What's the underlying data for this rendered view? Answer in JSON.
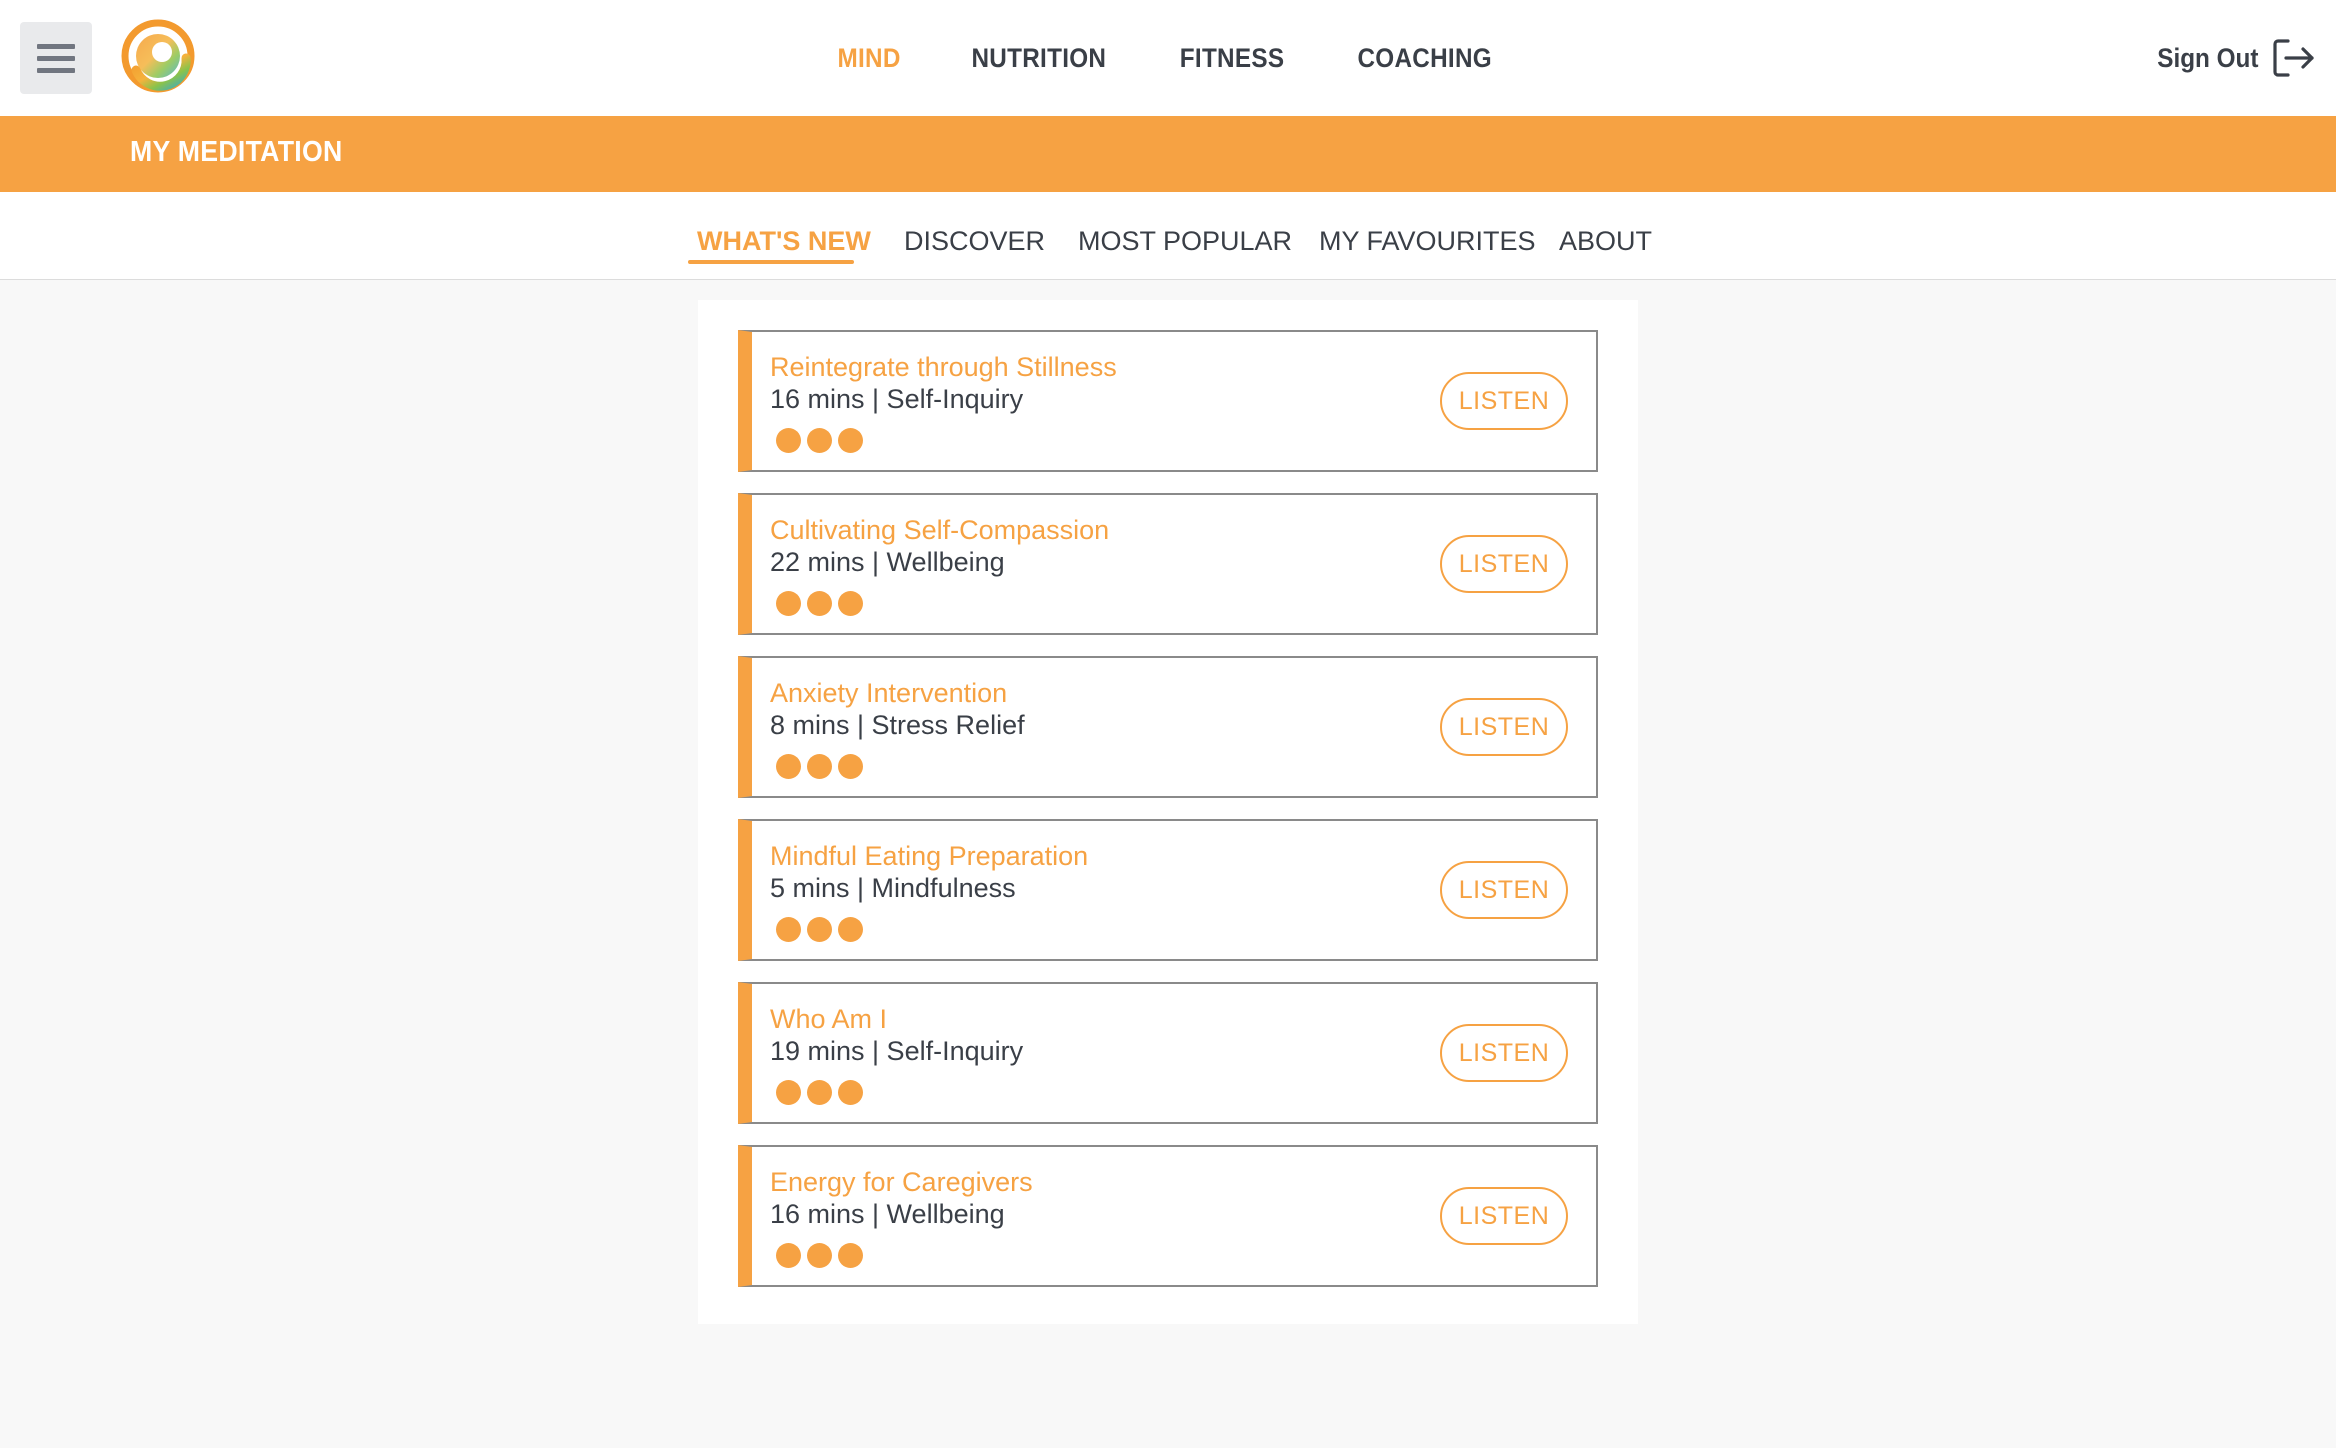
{
  "header": {
    "nav": [
      {
        "label": "MIND",
        "active": true
      },
      {
        "label": "NUTRITION",
        "active": false
      },
      {
        "label": "FITNESS",
        "active": false
      },
      {
        "label": "COACHING",
        "active": false
      }
    ],
    "sign_out_label": "Sign Out"
  },
  "band": {
    "title": "MY MEDITATION"
  },
  "tabs": [
    {
      "label": "WHAT'S NEW",
      "active": true
    },
    {
      "label": "DISCOVER",
      "active": false
    },
    {
      "label": "MOST POPULAR",
      "active": false
    },
    {
      "label": "MY FAVOURITES",
      "active": false
    },
    {
      "label": "ABOUT",
      "active": false
    }
  ],
  "meditations": [
    {
      "title": "Reintegrate through Stillness",
      "meta": "16 mins | Self-Inquiry",
      "action": "LISTEN"
    },
    {
      "title": "Cultivating Self-Compassion",
      "meta": "22 mins | Wellbeing",
      "action": "LISTEN"
    },
    {
      "title": "Anxiety Intervention",
      "meta": "8 mins | Stress Relief",
      "action": "LISTEN"
    },
    {
      "title": "Mindful Eating Preparation",
      "meta": "5 mins | Mindfulness",
      "action": "LISTEN"
    },
    {
      "title": "Who Am I",
      "meta": "19 mins | Self-Inquiry",
      "action": "LISTEN"
    },
    {
      "title": "Energy for Caregivers",
      "meta": "16 mins | Wellbeing",
      "action": "LISTEN"
    }
  ],
  "colors": {
    "accent": "#f6a243",
    "text": "#3a3f47",
    "background": "#f8f8f8"
  },
  "icons": [
    "menu-icon",
    "app-logo",
    "sign-out-icon"
  ]
}
